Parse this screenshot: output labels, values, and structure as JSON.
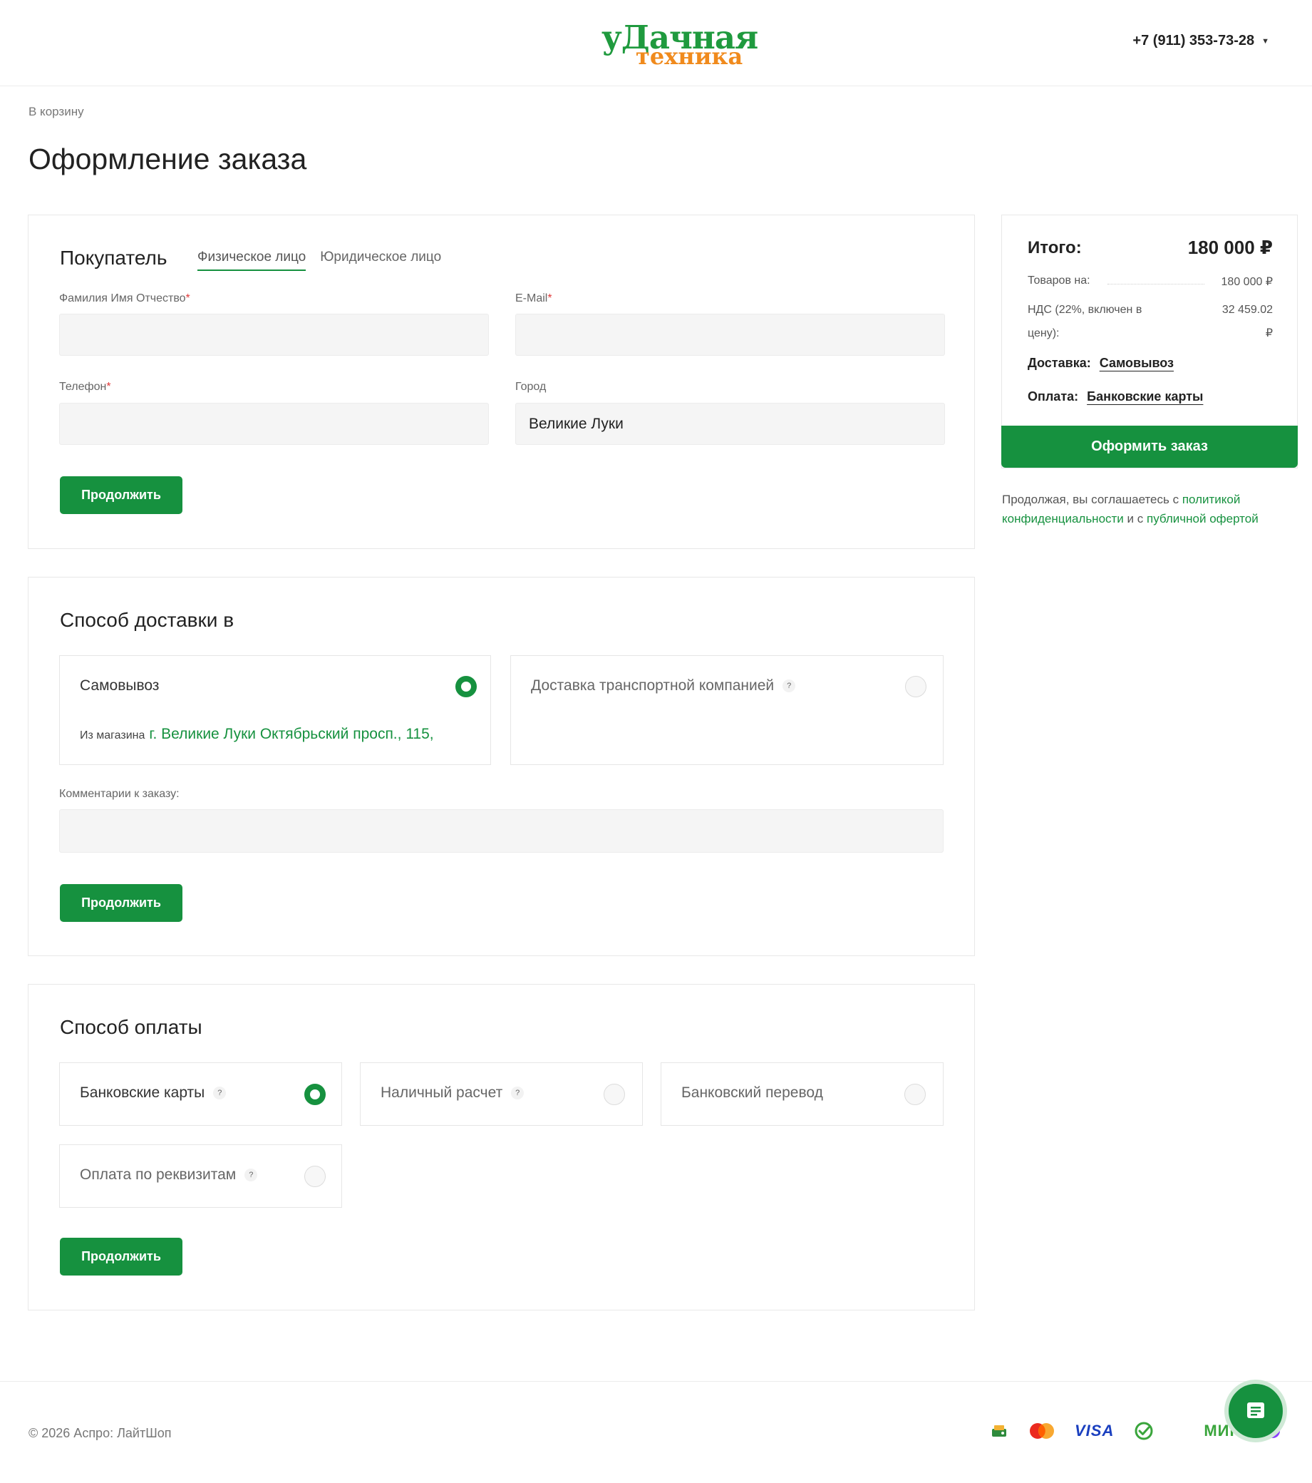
{
  "header": {
    "logo_line1": "уДачная",
    "logo_line2": "техника",
    "phone": "+7 (911) 353-73-28"
  },
  "breadcrumb": "В корзину",
  "page_title": "Оформление заказа",
  "buyer": {
    "title": "Покупатель",
    "tabs": [
      "Физическое лицо",
      "Юридическое лицо"
    ],
    "fields": {
      "fio_label": "Фамилия Имя Отчество",
      "email_label": "E-Mail",
      "phone_label": "Телефон",
      "city_label": "Город",
      "fio_value": "",
      "email_value": "",
      "phone_value": "",
      "city_value": "Великие Луки"
    },
    "required_mark": "*",
    "continue_label": "Продолжить"
  },
  "delivery": {
    "title": "Способ доставки в",
    "options": [
      {
        "label": "Самовывоз",
        "selected": true
      },
      {
        "label": "Доставка транспортной компанией",
        "selected": false
      }
    ],
    "store_prefix": "Из магазина",
    "store_address": "г. Великие Луки Октябрьский просп., 115,",
    "comment_label": "Комментарии к заказу:",
    "comment_value": "",
    "continue_label": "Продолжить",
    "help_mark": "?"
  },
  "payment": {
    "title": "Способ оплаты",
    "options": [
      {
        "label": "Банковские карты",
        "selected": true
      },
      {
        "label": "Наличный расчет",
        "selected": false
      },
      {
        "label": "Банковский перевод",
        "selected": false
      },
      {
        "label": "Оплата по реквизитам",
        "selected": false
      }
    ],
    "continue_label": "Продолжить",
    "help_mark": "?"
  },
  "summary": {
    "title": "Итого:",
    "total": "180 000 ₽",
    "goods_label": "Товаров на:",
    "goods_value": "180 000 ₽",
    "vat_label_line1": "НДС (22%, включен в",
    "vat_label_line2": "цену):",
    "vat_value_line1": "32 459.02",
    "vat_value_line2": "₽",
    "delivery_label": "Доставка:",
    "delivery_value": "Самовывоз",
    "payment_label": "Оплата:",
    "payment_value": "Банковские карты",
    "order_button": "Оформить заказ",
    "consent_text1": "Продолжая, вы соглашаетесь с ",
    "consent_link1": "политикой конфиденциальности",
    "consent_text2": " и с ",
    "consent_link2": "публичной офертой"
  },
  "footer": {
    "copyright": "© 2026 Аспро: ЛайтШоп",
    "payment_icons": [
      "sber-pay-icon",
      "mastercard-icon",
      "visa-icon",
      "sbp-icon",
      "mir-icon",
      "yoomoney-icon"
    ],
    "visa_text": "VISA",
    "mir_text": "МИР"
  },
  "colors": {
    "accent": "#16913f",
    "logo_green": "#1f9a3e",
    "logo_orange": "#f08a1c",
    "required": "#e03a3a"
  }
}
